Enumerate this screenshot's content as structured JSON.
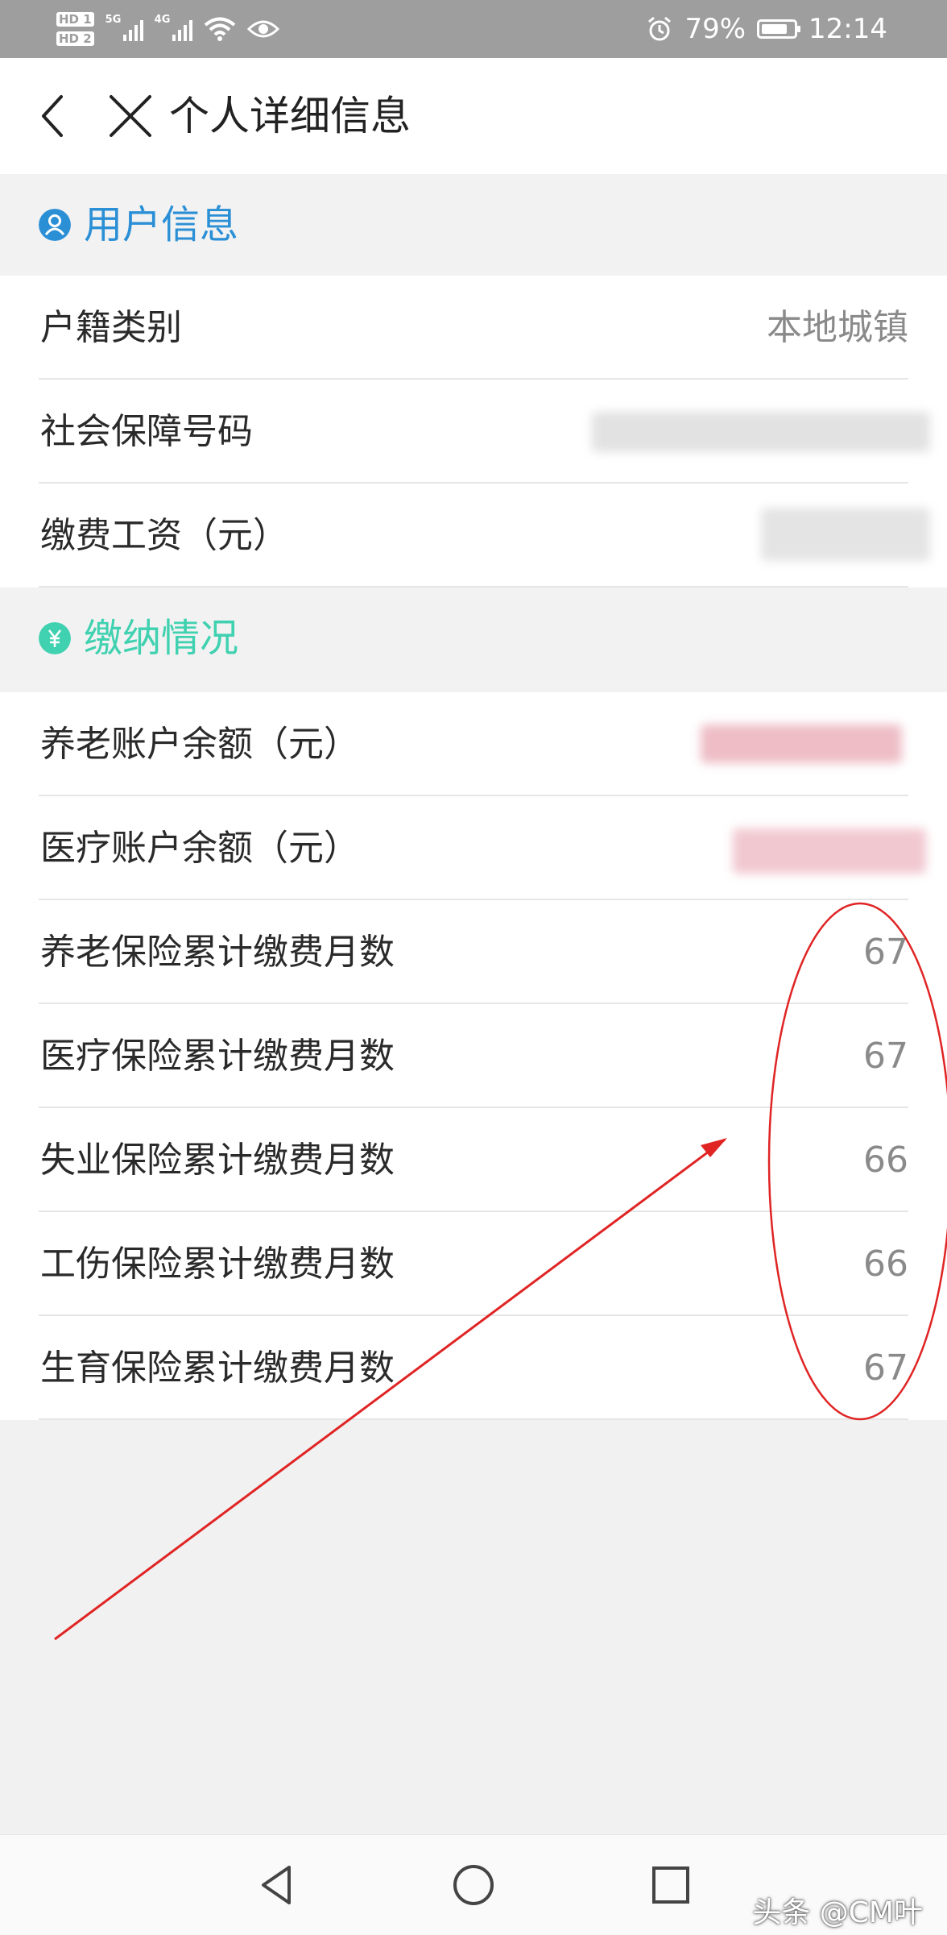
{
  "status_bar": {
    "hd1": "HD 1",
    "hd2": "HD 2",
    "net1": "5G",
    "net2": "4G",
    "battery_pct": "79%",
    "time": "12:14"
  },
  "nav": {
    "title": "个人详细信息",
    "back_icon": "chevron-left-icon",
    "close_icon": "close-icon"
  },
  "user_info": {
    "title": "用户信息",
    "icon": "user-icon",
    "accent": "#2b8fd6",
    "rows": [
      {
        "label": "户籍类别",
        "value": "本地城镇"
      },
      {
        "label": "社会保障号码",
        "value": ""
      },
      {
        "label": "缴费工资（元）",
        "value": ""
      }
    ]
  },
  "payment": {
    "title": "缴纳情况",
    "icon": "yen-icon",
    "accent": "#3fd1b0",
    "rows": [
      {
        "label": "养老账户余额（元）",
        "value": ""
      },
      {
        "label": "医疗账户余额（元）",
        "value": ""
      },
      {
        "label": "养老保险累计缴费月数",
        "value": "67"
      },
      {
        "label": "医疗保险累计缴费月数",
        "value": "67"
      },
      {
        "label": "失业保险累计缴费月数",
        "value": "66"
      },
      {
        "label": "工伤保险累计缴费月数",
        "value": "66"
      },
      {
        "label": "生育保险累计缴费月数",
        "value": "67"
      }
    ]
  },
  "annotation_color": "#e02424",
  "watermark": "头条 @CM叶"
}
